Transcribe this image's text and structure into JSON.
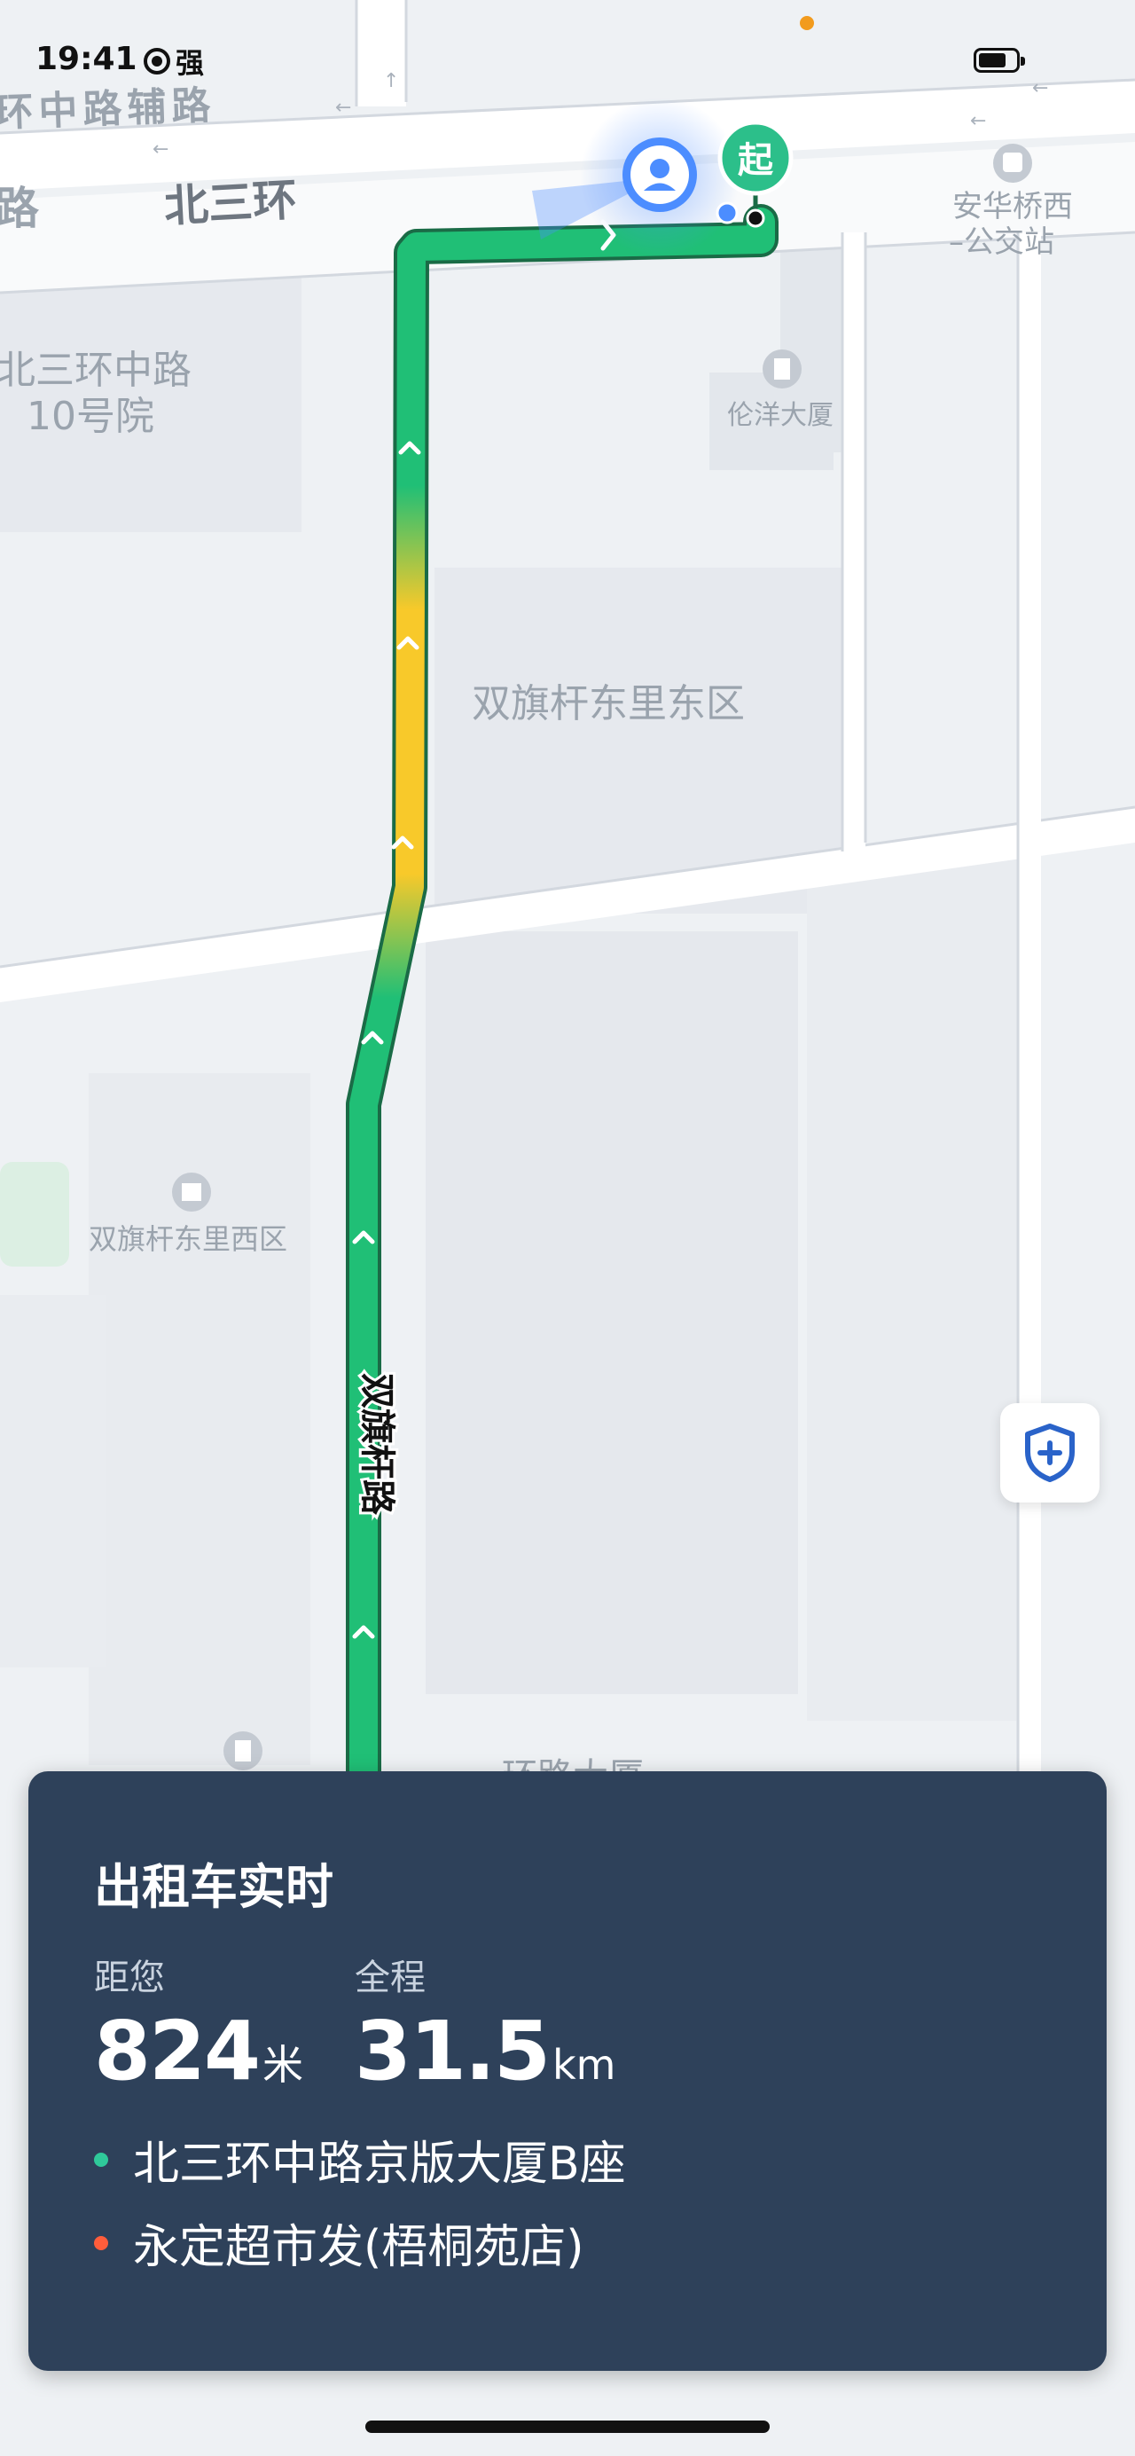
{
  "status_bar": {
    "time": "19:41",
    "signal_label": "强"
  },
  "map": {
    "road_labels": [
      "环中路辅路",
      "路",
      "北三环",
      "双旗杆路"
    ],
    "poi_labels": {
      "bus_stop_line1": "安华桥西",
      "bus_stop_line2": "–公交站",
      "building1": "伦洋大厦",
      "compound1_line1": "北三环中路",
      "compound1_line2": "10号院",
      "compound2": "双旗杆东里东区",
      "compound3": "双旗杆东里西区",
      "partial_label": "环路大厦"
    },
    "start_marker": "起",
    "route_colors": {
      "green": "#20bf76",
      "yellow": "#f8c92a",
      "outline": "#1a6b46"
    }
  },
  "safety_button": {
    "icon": "shield-plus-icon",
    "color": "#2a63c9"
  },
  "info_card": {
    "title": "出租车实时",
    "distance_label": "距您",
    "distance_value": "824",
    "distance_unit": "米",
    "total_label": "全程",
    "total_value": "31.5",
    "total_unit": "km",
    "origin": "北三环中路京版大厦B座",
    "origin_color": "#2fc99a",
    "destination": "永定超市发(梧桐苑店)",
    "destination_color": "#ff5d3b"
  }
}
